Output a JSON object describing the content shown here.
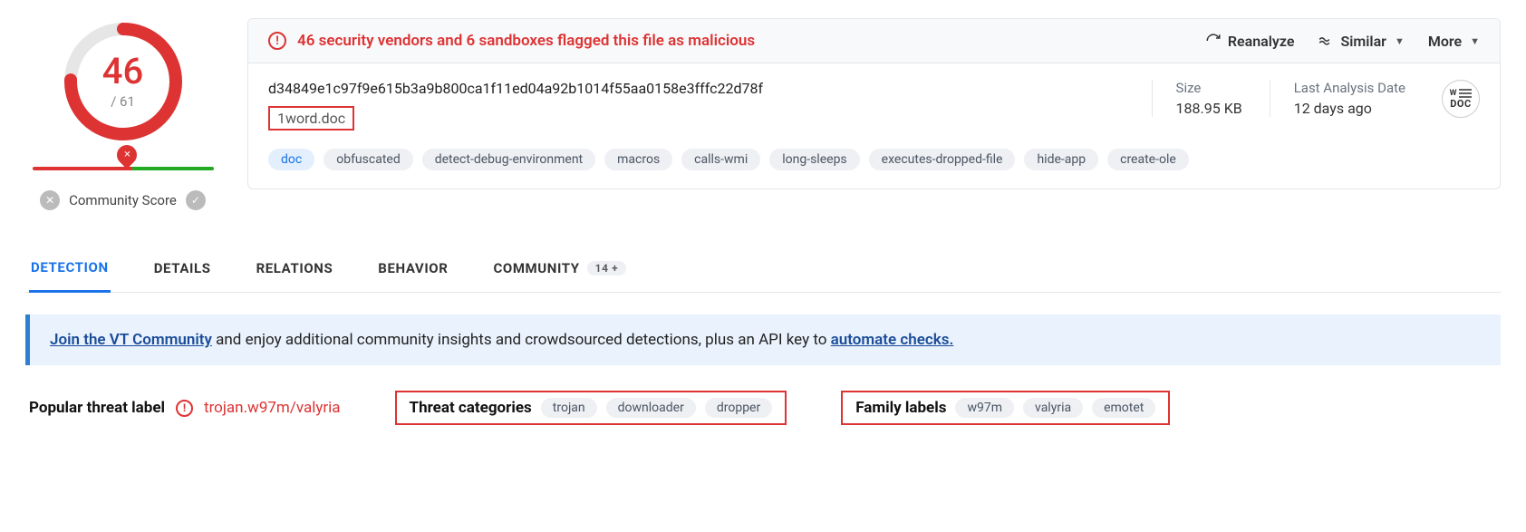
{
  "score": {
    "detections": "46",
    "total": "/ 61"
  },
  "community": {
    "label": "Community Score"
  },
  "alert": {
    "text": "46 security vendors and 6 sandboxes flagged this file as malicious"
  },
  "actions": {
    "reanalyze": "Reanalyze",
    "similar": "Similar",
    "more": "More"
  },
  "file": {
    "hash": "d34849e1c97f9e615b3a9b800ca1f11ed04a92b1014f55aa0158e3fffc22d78f",
    "name": "1word.doc",
    "size_label": "Size",
    "size_value": "188.95 KB",
    "date_label": "Last Analysis Date",
    "date_value": "12 days ago",
    "type_label": "DOC"
  },
  "tags": {
    "t0": "doc",
    "t1": "obfuscated",
    "t2": "detect-debug-environment",
    "t3": "macros",
    "t4": "calls-wmi",
    "t5": "long-sleeps",
    "t6": "executes-dropped-file",
    "t7": "hide-app",
    "t8": "create-ole"
  },
  "tabs": {
    "detection": "DETECTION",
    "details": "DETAILS",
    "relations": "RELATIONS",
    "behavior": "BEHAVIOR",
    "community": "COMMUNITY",
    "community_badge": "14 +"
  },
  "promo": {
    "link1": "Join the VT Community",
    "mid": " and enjoy additional community insights and crowdsourced detections, plus an API key to ",
    "link2": "automate checks."
  },
  "threat": {
    "popular_label": "Popular threat label",
    "popular_value": "trojan.w97m/valyria",
    "cat_label": "Threat categories",
    "cat0": "trojan",
    "cat1": "downloader",
    "cat2": "dropper",
    "fam_label": "Family labels",
    "fam0": "w97m",
    "fam1": "valyria",
    "fam2": "emotet"
  }
}
